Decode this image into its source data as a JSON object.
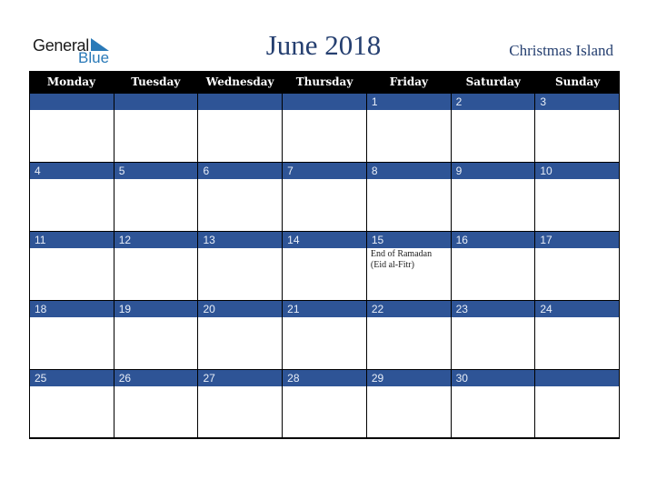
{
  "logo": {
    "line1": "General",
    "line2": "Blue",
    "icon": "triangle-flag-icon"
  },
  "header": {
    "title": "June 2018",
    "region": "Christmas Island"
  },
  "colors": {
    "accent": "#2e5496",
    "header_bg": "#000000",
    "title": "#253f70",
    "logo_blue": "#2a7ab8"
  },
  "weekdays": [
    "Monday",
    "Tuesday",
    "Wednesday",
    "Thursday",
    "Friday",
    "Saturday",
    "Sunday"
  ],
  "weeks": [
    [
      {
        "day": ""
      },
      {
        "day": ""
      },
      {
        "day": ""
      },
      {
        "day": ""
      },
      {
        "day": "1"
      },
      {
        "day": "2"
      },
      {
        "day": "3"
      }
    ],
    [
      {
        "day": "4"
      },
      {
        "day": "5"
      },
      {
        "day": "6"
      },
      {
        "day": "7"
      },
      {
        "day": "8"
      },
      {
        "day": "9"
      },
      {
        "day": "10"
      }
    ],
    [
      {
        "day": "11"
      },
      {
        "day": "12"
      },
      {
        "day": "13"
      },
      {
        "day": "14"
      },
      {
        "day": "15",
        "event": "End of Ramadan (Eid al-Fitr)"
      },
      {
        "day": "16"
      },
      {
        "day": "17"
      }
    ],
    [
      {
        "day": "18"
      },
      {
        "day": "19"
      },
      {
        "day": "20"
      },
      {
        "day": "21"
      },
      {
        "day": "22"
      },
      {
        "day": "23"
      },
      {
        "day": "24"
      }
    ],
    [
      {
        "day": "25"
      },
      {
        "day": "26"
      },
      {
        "day": "27"
      },
      {
        "day": "28"
      },
      {
        "day": "29"
      },
      {
        "day": "30"
      },
      {
        "day": ""
      }
    ]
  ]
}
